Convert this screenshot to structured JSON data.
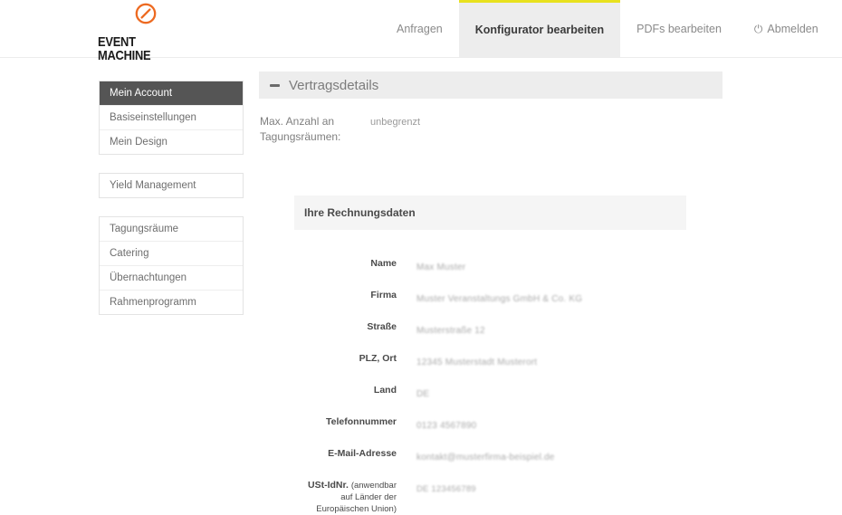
{
  "brand": {
    "logo_icon": "circle-slash-logo-icon",
    "logo_color": "#ed6a21",
    "line1": "EVENT",
    "line2": "MACHINE"
  },
  "nav": {
    "items": [
      {
        "label": "Anfragen",
        "active": false,
        "icon": null
      },
      {
        "label": "Konfigurator bearbeiten",
        "active": true,
        "icon": null
      },
      {
        "label": "PDFs bearbeiten",
        "active": false,
        "icon": null
      },
      {
        "label": "Abmelden",
        "active": false,
        "icon": "power-icon"
      }
    ],
    "active_accent_color": "#e8e11e"
  },
  "sidebar": {
    "groups": [
      {
        "items": [
          {
            "label": "Mein Account",
            "active": true
          },
          {
            "label": "Basiseinstellungen",
            "active": false
          },
          {
            "label": "Mein Design",
            "active": false
          }
        ]
      },
      {
        "items": [
          {
            "label": "Yield Management",
            "active": false
          }
        ]
      },
      {
        "items": [
          {
            "label": "Tagungsräume",
            "active": false
          },
          {
            "label": "Catering",
            "active": false
          },
          {
            "label": "Übernachtungen",
            "active": false
          },
          {
            "label": "Rahmenprogramm",
            "active": false
          }
        ]
      }
    ]
  },
  "contract_panel": {
    "collapse_icon": "minus-icon",
    "title": "Vertragsdetails",
    "rows": [
      {
        "label": "Max. Anzahl an Tagungsräumen:",
        "value": "unbegrenzt"
      }
    ]
  },
  "invoice_panel": {
    "title": "Ihre Rechnungsdaten",
    "fields": [
      {
        "label": "Name",
        "note": "",
        "value": "Max Muster",
        "redacted": true
      },
      {
        "label": "Firma",
        "note": "",
        "value": "Muster Veranstaltungs GmbH & Co. KG",
        "redacted": true
      },
      {
        "label": "Straße",
        "note": "",
        "value": "Musterstraße 12",
        "redacted": true
      },
      {
        "label": "PLZ, Ort",
        "note": "",
        "value": "12345 Musterstadt Musterort",
        "redacted": true
      },
      {
        "label": "Land",
        "note": "",
        "value": "DE",
        "redacted": true
      },
      {
        "label": "Telefonnummer",
        "note": "",
        "value": "0123 4567890",
        "redacted": true
      },
      {
        "label": "E-Mail-Adresse",
        "note": "",
        "value": "kontakt@musterfirma-beispiel.de",
        "redacted": true
      },
      {
        "label": "USt-IdNr.",
        "note": "(anwendbar auf Länder der Europäischen Union)",
        "value": "DE 123456789",
        "redacted": true
      }
    ]
  }
}
